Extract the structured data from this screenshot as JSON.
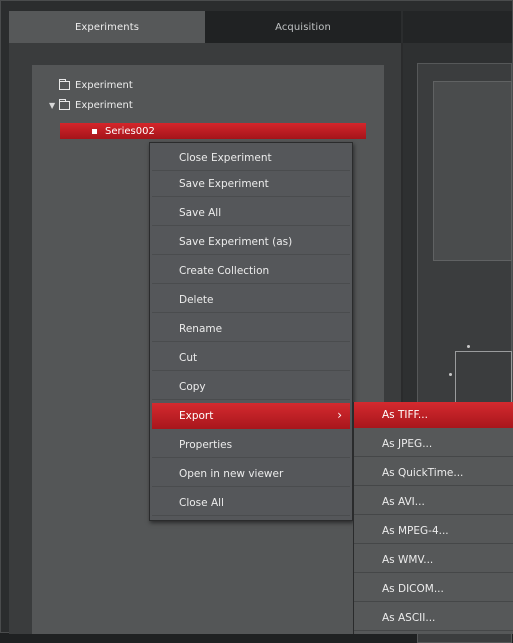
{
  "tabs": [
    {
      "label": "Experiments",
      "active": true
    },
    {
      "label": "Acquisition",
      "active": false
    }
  ],
  "tree": {
    "items": [
      {
        "label": "Experiment",
        "expanded": false
      },
      {
        "label": "Experiment",
        "expanded": true
      }
    ],
    "selected_series": "Series002"
  },
  "context_menu": {
    "items": [
      {
        "label": "Close Experiment"
      },
      {
        "label": "Save Experiment"
      },
      {
        "label": "Save All"
      },
      {
        "label": "Save Experiment (as)"
      },
      {
        "label": "Create Collection"
      },
      {
        "label": "Delete"
      },
      {
        "label": "Rename"
      },
      {
        "label": "Cut"
      },
      {
        "label": "Copy"
      },
      {
        "label": "Export",
        "has_submenu": true,
        "highlighted": true
      },
      {
        "label": "Properties"
      },
      {
        "label": "Open in new viewer"
      },
      {
        "label": "Close All"
      }
    ],
    "submenu_arrow": "›"
  },
  "export_submenu": {
    "items": [
      {
        "label": "As TIFF...",
        "highlighted": true
      },
      {
        "label": "As JPEG..."
      },
      {
        "label": "As QuickTime..."
      },
      {
        "label": "As AVI..."
      },
      {
        "label": "As MPEG-4..."
      },
      {
        "label": "As WMV..."
      },
      {
        "label": "As DICOM..."
      },
      {
        "label": "As ASCII..."
      }
    ]
  },
  "colors": {
    "highlight": "#c41e24",
    "panel_bg": "#545657",
    "menu_bg": "#55575a"
  }
}
